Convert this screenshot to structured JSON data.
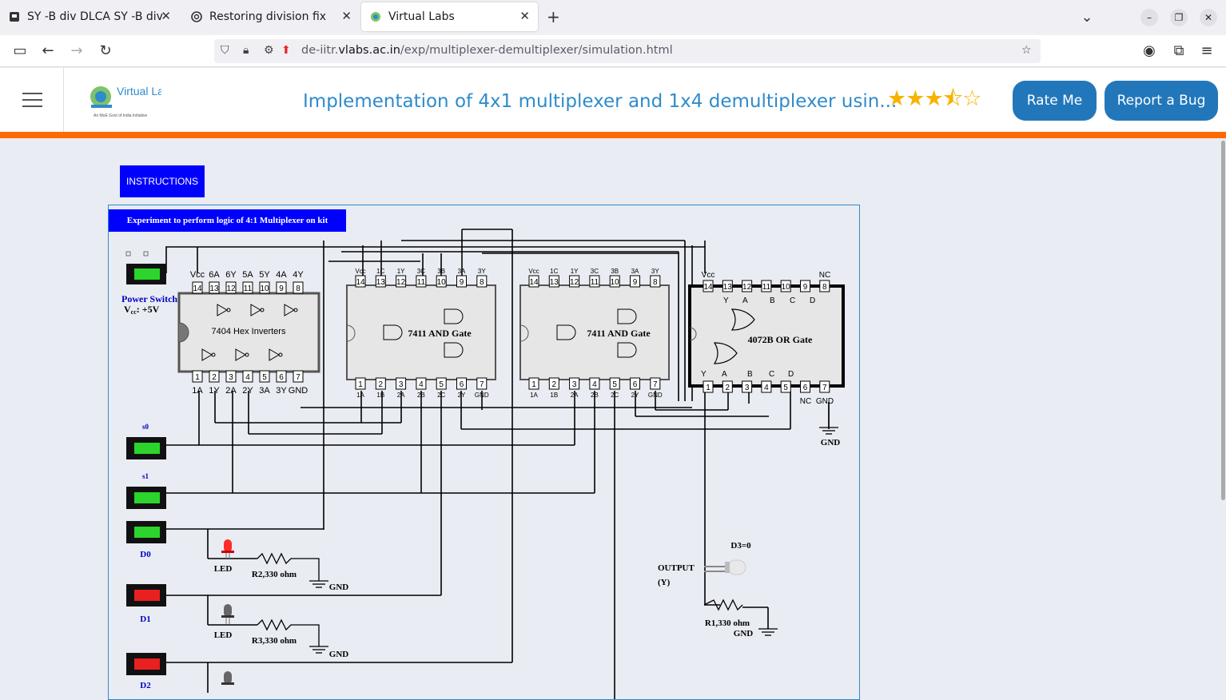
{
  "browser": {
    "tabs": [
      {
        "title": "SY -B div DLCA SY -B div"
      },
      {
        "title": "Restoring division fix"
      },
      {
        "title": "Virtual Labs"
      }
    ],
    "url_prefix": "de-iitr.",
    "url_domain": "vlabs.ac.in",
    "url_path": "/exp/multiplexer-demultiplexer/simulation.html"
  },
  "header": {
    "logo_text": "Virtual Labs",
    "logo_sub": "An MoE Govt of India Initiative",
    "title": "Implementation of 4x1 multiplexer and 1x4 demultiplexer usin...",
    "rating": 3.5,
    "rate_button": "Rate Me",
    "bug_button": "Report a Bug"
  },
  "instructions_button": "INSTRUCTIONS",
  "panel_title": "Experiment to perform logic of 4:1 Multiplexer on kit",
  "circuit": {
    "power_label": "Power Switch",
    "vcc_label_main": "V",
    "vcc_label_sub": "cc",
    "vcc_label_rest": ": +5V",
    "s0_label": "s0",
    "s1_label": "s1",
    "d0_label": "D0",
    "d1_label": "D1",
    "d2_label": "D2",
    "led_label": "LED",
    "r2_label": "R2,330 ohm",
    "r3_label": "R3,330 ohm",
    "r1_label": "R1,330 ohm",
    "gnd_label": "GND",
    "output_label": "OUTPUT",
    "output_y": "(Y)",
    "d3_label": "D3=0",
    "ic_inverter": "7404 Hex Inverters",
    "ic_and": "7411 AND Gate",
    "ic_or": "4072B OR Gate",
    "inv_top_pins": [
      "Vcc",
      "6A",
      "6Y",
      "5A",
      "5Y",
      "4A",
      "4Y"
    ],
    "inv_top_nums": [
      "14",
      "13",
      "12",
      "11",
      "10",
      "9",
      "8"
    ],
    "inv_bot_pins": [
      "1A",
      "1Y",
      "2A",
      "2Y",
      "3A",
      "3Y",
      "GND"
    ],
    "inv_bot_nums": [
      "1",
      "2",
      "3",
      "4",
      "5",
      "6",
      "7"
    ],
    "and_top_pins": [
      "Vcc",
      "1C",
      "1Y",
      "3C",
      "3B",
      "3A",
      "3Y"
    ],
    "and_bot_pins": [
      "1A",
      "1B",
      "2A",
      "2B",
      "2C",
      "2Y",
      "GND"
    ],
    "or_top_nums": [
      "14",
      "13",
      "12",
      "11",
      "10",
      "9",
      "8"
    ],
    "or_bot_nums": [
      "1",
      "2",
      "3",
      "4",
      "5",
      "6",
      "7"
    ],
    "or_top_vcc": "Vcc",
    "or_top_nc": "NC",
    "or_bot_nc": "NC",
    "or_bot_gnd": "GND",
    "or_gate_letters": [
      "Y",
      "A",
      "B",
      "C",
      "D"
    ],
    "switches": {
      "power": "on",
      "s0": "on",
      "s1": "on",
      "d0": "on",
      "d1": "off",
      "d2": "off"
    },
    "led_states": {
      "d0": "on",
      "d1": "off",
      "d2": "off",
      "output": "off"
    }
  },
  "colors": {
    "orange": "#ff6a00",
    "brand_blue": "#2277bb",
    "title_blue": "#2f8bcb",
    "instr_blue": "#0000ff",
    "switch_on": "#2bd52b",
    "switch_off": "#e82020"
  }
}
